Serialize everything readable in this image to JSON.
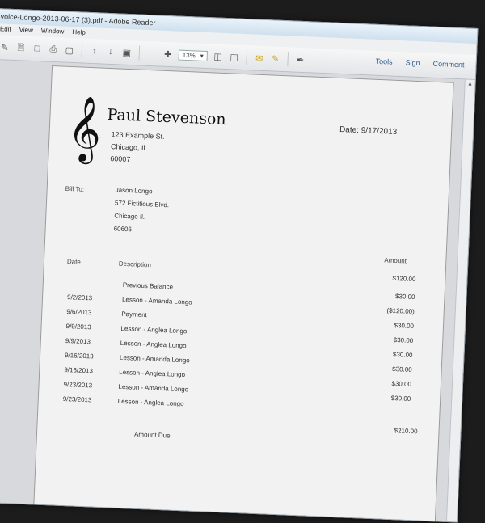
{
  "window": {
    "title": "voice-Longo-2013-06-17 (3).pdf - Adobe Reader"
  },
  "menu": {
    "items": [
      "Edit",
      "View",
      "Window",
      "Help"
    ]
  },
  "toolbar": {
    "zoom": "13%",
    "right_links": [
      "Tools",
      "Sign",
      "Comment"
    ]
  },
  "invoice": {
    "from_name": "Paul Stevenson",
    "from_address": [
      "123 Example St.",
      "Chicago, Il.",
      "60007"
    ],
    "date": "Date: 9/17/2013",
    "bill_to_label": "Bill To:",
    "bill_to": [
      "Jason Longo",
      "572 Fictitious Blvd.",
      "Chicago Il.",
      "60606"
    ],
    "col_date": "Date",
    "col_description": "Description",
    "col_amount": "Amount",
    "top_amount": "$120.00",
    "rows": [
      {
        "date": "",
        "description": "Previous Balance",
        "amount": "$30.00"
      },
      {
        "date": "9/2/2013",
        "description": "Lesson - Amanda Longo",
        "amount": "($120.00)"
      },
      {
        "date": "9/6/2013",
        "description": "Payment",
        "amount": "$30.00"
      },
      {
        "date": "9/9/2013",
        "description": "Lesson - Anglea Longo",
        "amount": "$30.00"
      },
      {
        "date": "9/9/2013",
        "description": "Lesson - Anglea Longo",
        "amount": "$30.00"
      },
      {
        "date": "9/16/2013",
        "description": "Lesson - Amanda Longo",
        "amount": "$30.00"
      },
      {
        "date": "9/16/2013",
        "description": "Lesson - Anglea Longo",
        "amount": "$30.00"
      },
      {
        "date": "9/23/2013",
        "description": "Lesson - Amanda Longo",
        "amount": "$30.00"
      },
      {
        "date": "9/23/2013",
        "description": "Lesson - Anglea Longo",
        "amount": ""
      }
    ],
    "amount_due_label": "Amount Due:",
    "amount_due": "$210.00"
  }
}
